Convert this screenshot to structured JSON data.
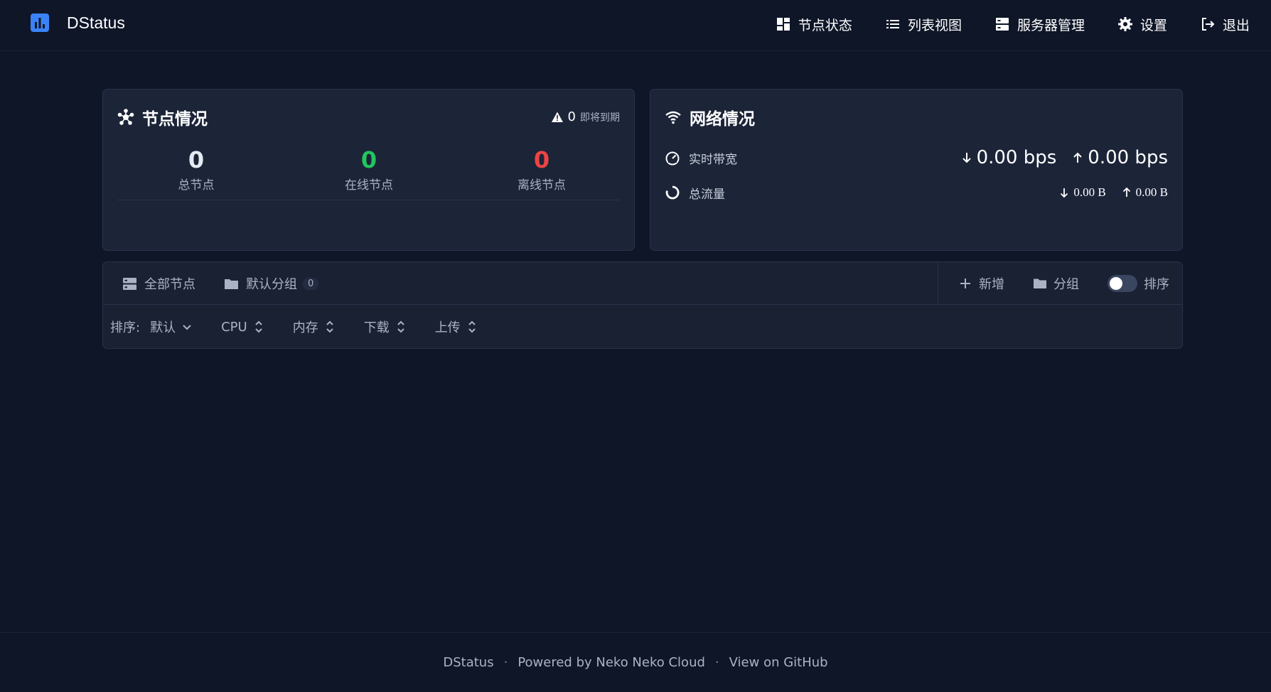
{
  "header": {
    "app_name": "DStatus",
    "nav": [
      {
        "label": "节点状态",
        "icon": "dashboard-icon"
      },
      {
        "label": "列表视图",
        "icon": "list-icon"
      },
      {
        "label": "服务器管理",
        "icon": "server-icon"
      },
      {
        "label": "设置",
        "icon": "gear-icon"
      },
      {
        "label": "退出",
        "icon": "logout-icon"
      }
    ]
  },
  "nodes_card": {
    "title": "节点情况",
    "expiring_count": "0",
    "expiring_label": "即将到期",
    "stats": [
      {
        "value": "0",
        "label": "总节点",
        "color": "#e5e9f2"
      },
      {
        "value": "0",
        "label": "在线节点",
        "color": "#22c55e"
      },
      {
        "value": "0",
        "label": "离线节点",
        "color": "#ef4444"
      }
    ]
  },
  "network_card": {
    "title": "网络情况",
    "realtime_label": "实时带宽",
    "realtime_down": "0.00 bps",
    "realtime_up": "0.00 bps",
    "total_label": "总流量",
    "total_down": "0.00 B",
    "total_up": "0.00 B"
  },
  "groups": {
    "tabs": [
      {
        "label": "全部节点",
        "icon": "server-list-icon"
      },
      {
        "label": "默认分组",
        "icon": "folder-icon",
        "count": "0"
      }
    ],
    "actions": {
      "add_label": "新增",
      "group_label": "分组",
      "sort_toggle_label": "排序"
    },
    "sort_label": "排序:",
    "sort_options": [
      "默认",
      "CPU",
      "内存",
      "下载",
      "上传"
    ]
  },
  "footer": {
    "brand": "DStatus",
    "separator": "·",
    "powered_by": "Powered by Neko Neko Cloud",
    "github": "View on GitHub"
  },
  "colors": {
    "accent": "#3b82f6",
    "online": "#22c55e",
    "offline": "#ef4444"
  }
}
